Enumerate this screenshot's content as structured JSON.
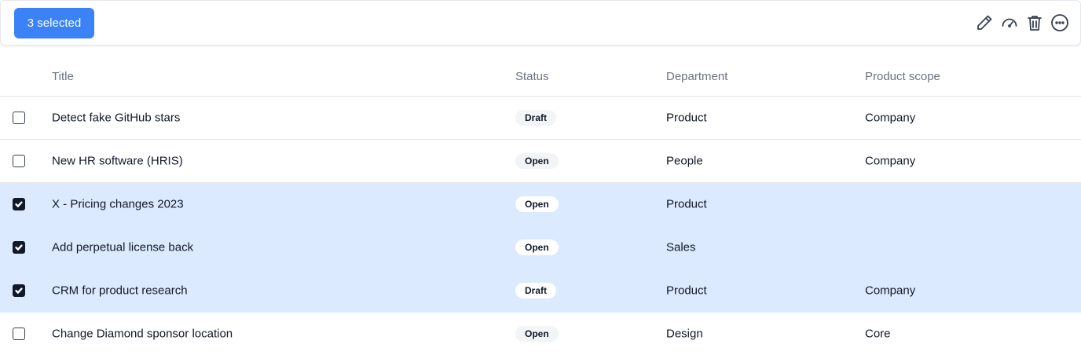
{
  "toolbar": {
    "selected_label": "3 selected",
    "icons": [
      "pencil-icon",
      "gauge-icon",
      "trash-icon",
      "more-icon"
    ]
  },
  "table": {
    "headers": {
      "title": "Title",
      "status": "Status",
      "department": "Department",
      "scope": "Product scope"
    },
    "rows": [
      {
        "checked": false,
        "title": "Detect fake GitHub stars",
        "status": "Draft",
        "department": "Product",
        "scope": "Company"
      },
      {
        "checked": false,
        "title": "New HR software (HRIS)",
        "status": "Open",
        "department": "People",
        "scope": "Company"
      },
      {
        "checked": true,
        "title": "X - Pricing changes 2023",
        "status": "Open",
        "department": "Product",
        "scope": ""
      },
      {
        "checked": true,
        "title": "Add perpetual license back",
        "status": "Open",
        "department": "Sales",
        "scope": ""
      },
      {
        "checked": true,
        "title": "CRM for product research",
        "status": "Draft",
        "department": "Product",
        "scope": "Company"
      },
      {
        "checked": false,
        "title": "Change Diamond sponsor location",
        "status": "Open",
        "department": "Design",
        "scope": "Core"
      }
    ]
  },
  "colors": {
    "accent": "#3b82f6",
    "selected_row": "#dbeafe"
  }
}
